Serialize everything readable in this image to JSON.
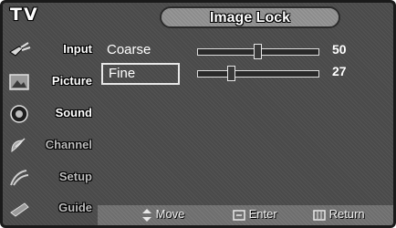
{
  "header": {
    "mode": "TV",
    "title": "Image Lock"
  },
  "sidebar": {
    "items": [
      {
        "label": "Input",
        "icon": "plug-icon"
      },
      {
        "label": "Picture",
        "icon": "picture-icon"
      },
      {
        "label": "Sound",
        "icon": "speaker-icon"
      },
      {
        "label": "Channel",
        "icon": "satellite-dish-icon"
      },
      {
        "label": "Setup",
        "icon": "setup-icon"
      },
      {
        "label": "Guide",
        "icon": "guide-icon"
      }
    ]
  },
  "settings": {
    "rows": [
      {
        "label": "Coarse",
        "value": "50",
        "level": 0.5,
        "selected": false
      },
      {
        "label": "Fine",
        "value": "27",
        "level": 0.27,
        "selected": true
      }
    ]
  },
  "footer": {
    "move": {
      "label": "Move",
      "icon": "up-down-arrows-icon"
    },
    "enter": {
      "label": "Enter",
      "icon": "enter-icon"
    },
    "return": {
      "label": "Return",
      "icon": "return-icon"
    }
  }
}
